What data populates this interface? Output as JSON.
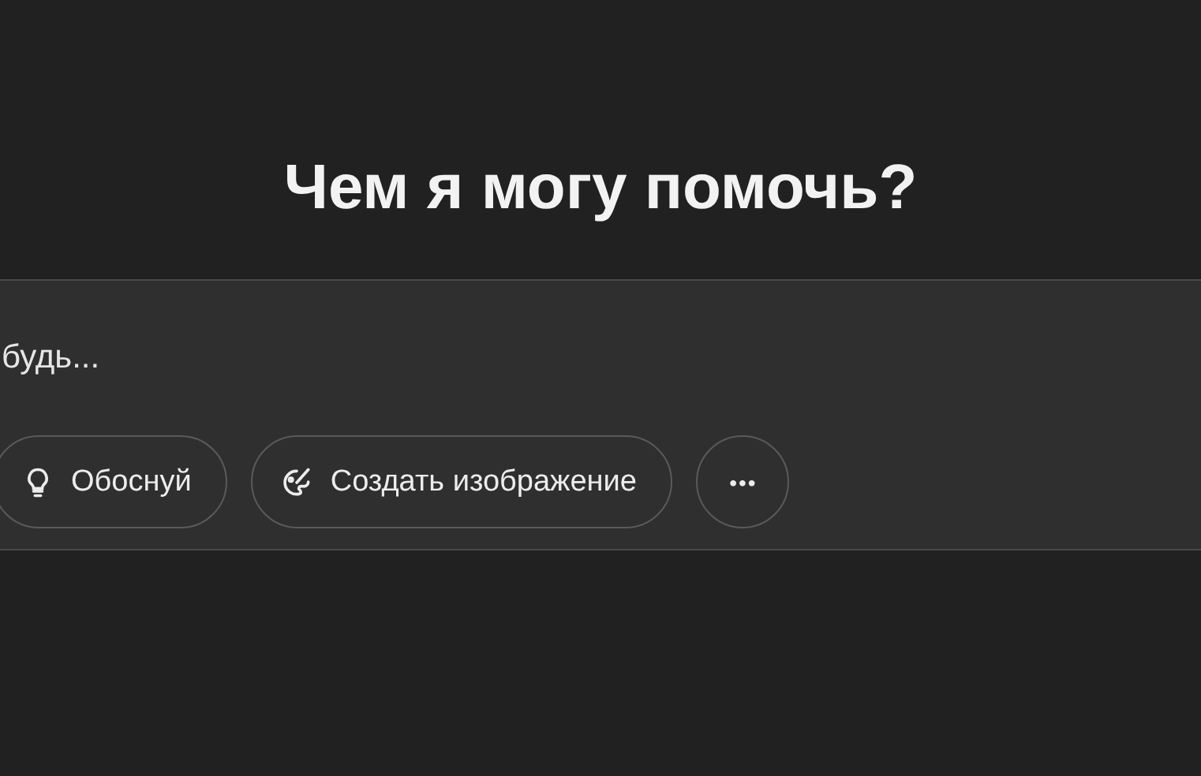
{
  "heading": "Чем я могу помочь?",
  "composer": {
    "placeholder": "будь..."
  },
  "actions": [
    {
      "kind": "idea",
      "label": "Обоснуй"
    },
    {
      "kind": "image",
      "label": "Создать изображение"
    },
    {
      "kind": "more",
      "label": "•••"
    }
  ]
}
